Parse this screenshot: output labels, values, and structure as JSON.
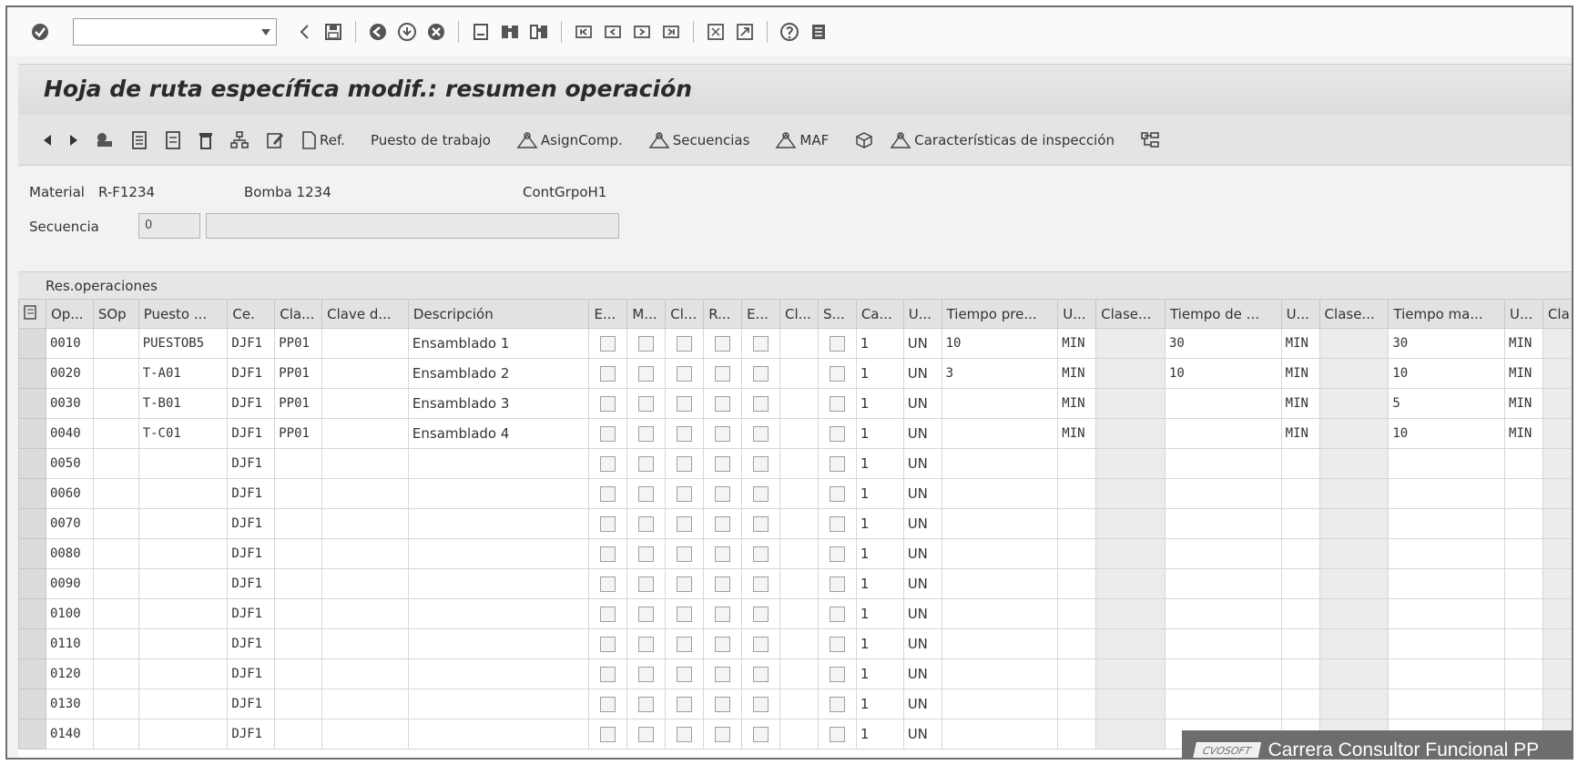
{
  "toolbar": {
    "command_placeholder": ""
  },
  "title": "Hoja de ruta específica modif.: resumen operación",
  "app_toolbar": {
    "ref_label": "Ref.",
    "puesto_label": "Puesto de trabajo",
    "asigncomp_label": "AsignComp.",
    "secuencias_label": "Secuencias",
    "maf_label": "MAF",
    "caracteristicas_label": "Características de inspección"
  },
  "header": {
    "material_label": "Material",
    "material_value": "R-F1234",
    "material_desc": "Bomba 1234",
    "cont_label": "ContGrpoH1",
    "secuencia_label": "Secuencia",
    "secuencia_value": "0",
    "secuencia_desc": ""
  },
  "group_title": "Res.operaciones",
  "table": {
    "columns": [
      "Op...",
      "SOp",
      "Puesto ...",
      "Ce.",
      "Cla...",
      "Clave d...",
      "Descripción",
      "E...",
      "M...",
      "Cl...",
      "R...",
      "E...",
      "Cl...",
      "S...",
      "Ca...",
      "U...",
      "Tiempo pre...",
      "U...",
      "Clase...",
      "Tiempo de ...",
      "U...",
      "Clase...",
      "Tiempo ma...",
      "U...",
      "Cla"
    ],
    "rows": [
      {
        "op": "0010",
        "puesto": "PUESTOB5",
        "ce": "DJF1",
        "cla": "PP01",
        "desc": "Ensamblado 1",
        "ca": "1",
        "un": "UN",
        "t1": "10",
        "u1": "MIN",
        "t2": "30",
        "u2": "MIN",
        "t3": "30",
        "u3": "MIN"
      },
      {
        "op": "0020",
        "puesto": "T-A01",
        "ce": "DJF1",
        "cla": "PP01",
        "desc": "Ensamblado 2",
        "ca": "1",
        "un": "UN",
        "t1": "3",
        "u1": "MIN",
        "t2": "10",
        "u2": "MIN",
        "t3": "10",
        "u3": "MIN"
      },
      {
        "op": "0030",
        "puesto": "T-B01",
        "ce": "DJF1",
        "cla": "PP01",
        "desc": "Ensamblado 3",
        "ca": "1",
        "un": "UN",
        "t1": "",
        "u1": "MIN",
        "t2": "",
        "u2": "MIN",
        "t3": "5",
        "u3": "MIN"
      },
      {
        "op": "0040",
        "puesto": "T-C01",
        "ce": "DJF1",
        "cla": "PP01",
        "desc": "Ensamblado 4",
        "ca": "1",
        "un": "UN",
        "t1": "",
        "u1": "MIN",
        "t2": "",
        "u2": "MIN",
        "t3": "10",
        "u3": "MIN"
      },
      {
        "op": "0050",
        "puesto": "",
        "ce": "DJF1",
        "cla": "",
        "desc": "",
        "ca": "1",
        "un": "UN",
        "t1": "",
        "u1": "",
        "t2": "",
        "u2": "",
        "t3": "",
        "u3": ""
      },
      {
        "op": "0060",
        "puesto": "",
        "ce": "DJF1",
        "cla": "",
        "desc": "",
        "ca": "1",
        "un": "UN",
        "t1": "",
        "u1": "",
        "t2": "",
        "u2": "",
        "t3": "",
        "u3": ""
      },
      {
        "op": "0070",
        "puesto": "",
        "ce": "DJF1",
        "cla": "",
        "desc": "",
        "ca": "1",
        "un": "UN",
        "t1": "",
        "u1": "",
        "t2": "",
        "u2": "",
        "t3": "",
        "u3": ""
      },
      {
        "op": "0080",
        "puesto": "",
        "ce": "DJF1",
        "cla": "",
        "desc": "",
        "ca": "1",
        "un": "UN",
        "t1": "",
        "u1": "",
        "t2": "",
        "u2": "",
        "t3": "",
        "u3": ""
      },
      {
        "op": "0090",
        "puesto": "",
        "ce": "DJF1",
        "cla": "",
        "desc": "",
        "ca": "1",
        "un": "UN",
        "t1": "",
        "u1": "",
        "t2": "",
        "u2": "",
        "t3": "",
        "u3": ""
      },
      {
        "op": "0100",
        "puesto": "",
        "ce": "DJF1",
        "cla": "",
        "desc": "",
        "ca": "1",
        "un": "UN",
        "t1": "",
        "u1": "",
        "t2": "",
        "u2": "",
        "t3": "",
        "u3": ""
      },
      {
        "op": "0110",
        "puesto": "",
        "ce": "DJF1",
        "cla": "",
        "desc": "",
        "ca": "1",
        "un": "UN",
        "t1": "",
        "u1": "",
        "t2": "",
        "u2": "",
        "t3": "",
        "u3": ""
      },
      {
        "op": "0120",
        "puesto": "",
        "ce": "DJF1",
        "cla": "",
        "desc": "",
        "ca": "1",
        "un": "UN",
        "t1": "",
        "u1": "",
        "t2": "",
        "u2": "",
        "t3": "",
        "u3": ""
      },
      {
        "op": "0130",
        "puesto": "",
        "ce": "DJF1",
        "cla": "",
        "desc": "",
        "ca": "1",
        "un": "UN",
        "t1": "",
        "u1": "",
        "t2": "",
        "u2": "",
        "t3": "",
        "u3": ""
      },
      {
        "op": "0140",
        "puesto": "",
        "ce": "DJF1",
        "cla": "",
        "desc": "",
        "ca": "1",
        "un": "UN",
        "t1": "",
        "u1": "",
        "t2": "",
        "u2": "",
        "t3": "",
        "u3": ""
      }
    ]
  },
  "badge": {
    "logo_text": "CVOSOFT",
    "text": "Carrera Consultor Funcional PP"
  }
}
